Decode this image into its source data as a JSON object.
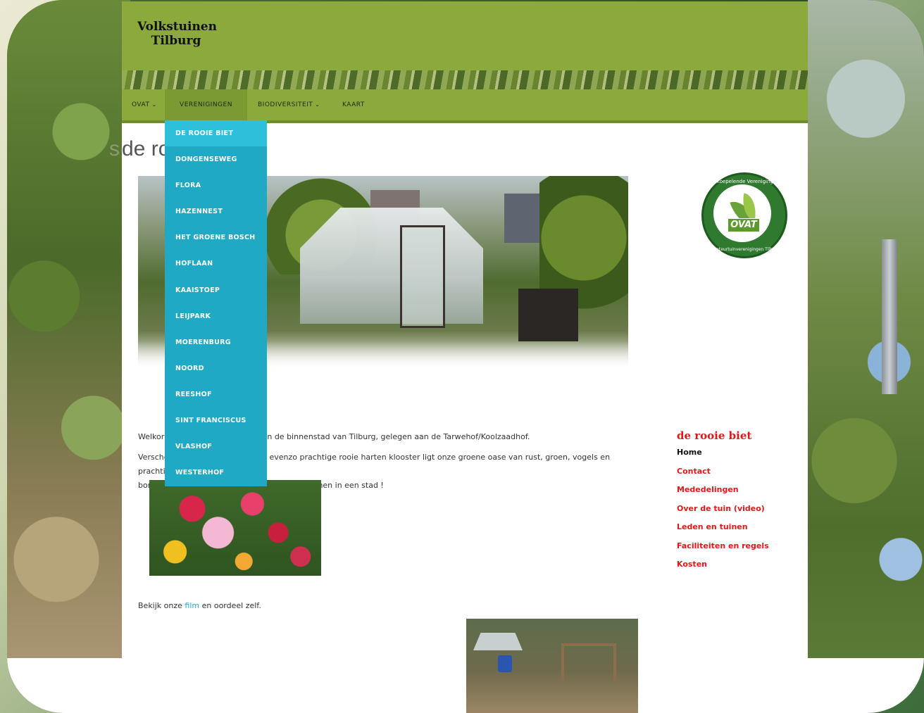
{
  "site": {
    "title_line1": "Volkstuinen",
    "title_line2": "Tilburg"
  },
  "nav": {
    "items": [
      {
        "label": "OVAT",
        "has_submenu": true
      },
      {
        "label": "VERENIGINGEN",
        "has_submenu": false,
        "active": true
      },
      {
        "label": "BIODIVERSITEIT",
        "has_submenu": true
      },
      {
        "label": "KAART",
        "has_submenu": false
      }
    ],
    "chevron": "⌄"
  },
  "dropdown": {
    "items": [
      "DE ROOIE BIET",
      "DONGENSEWEG",
      "FLORA",
      "HAZENNEST",
      "HET GROENE BOSCH",
      "HOFLAAN",
      "KAAISTOEP",
      "LEIJPARK",
      "MOERENBURG",
      "NOORD",
      "REESHOF",
      "SINT FRANCISCUS",
      "VLASHOF",
      "WESTERHOF"
    ]
  },
  "page": {
    "title_visible": "de ro",
    "title_ghost": "s",
    "welcome_left": "Welkor",
    "welcome_right": "in de binnenstad van Tilburg, gelegen aan de Tarwehof/Koolzaadhof.",
    "p2_line1_left": "Versche",
    "p2_line1_right": "evenzo prachtige rooie harten klooster ligt onze groene oase van rust, groen, vogels en prachtige",
    "p2_line2_left": "bomen",
    "p2_line2_right": "onder te noemen in een stad !",
    "film_before": "Bekijk onze ",
    "film_link": "film",
    "film_after": " en oordeel zelf."
  },
  "logo": {
    "text": "OVAT",
    "ring_top": "Overkoepelende Vereniging van",
    "ring_bottom": "Amateurtuinverenigingen Tilburg"
  },
  "sidebar": {
    "title": "de rooie biet",
    "links": [
      "Home",
      "Contact",
      "Mededelingen",
      "Over de tuin (video)",
      "Leden en tuinen",
      "Faciliteiten en regels",
      "Kosten"
    ]
  },
  "colors": {
    "header": "#8ca93c",
    "dropdown": "#1fa9c5",
    "sidebar_link": "#e01818",
    "accent_link": "#2eaed0"
  }
}
